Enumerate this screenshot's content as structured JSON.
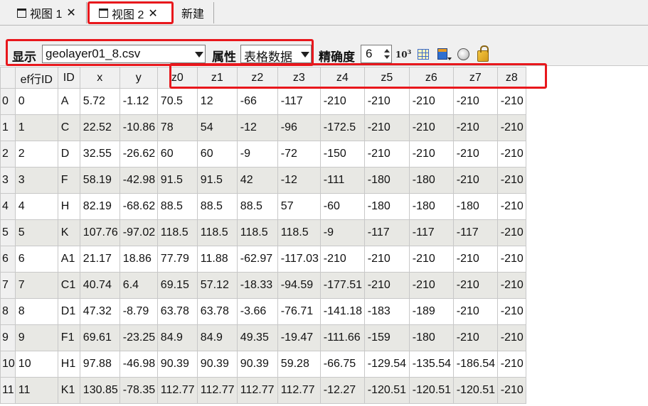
{
  "tabs": [
    {
      "label": "视图 1",
      "icon": "window-icon",
      "close": "✕"
    },
    {
      "label": "视图 2",
      "icon": "window-icon",
      "close": "✕",
      "active": true
    },
    {
      "label": "新建"
    }
  ],
  "toolbar": {
    "display_label": "显示",
    "file_combo_value": "geolayer01_8.csv",
    "property_label": "属性",
    "property_combo_value": "表格数据",
    "precision_label": "精确度",
    "precision_value": "6",
    "exp_icon_text": "10",
    "exp_icon_sup": "3",
    "icons": [
      "exponent-icon",
      "grid-icon",
      "table-dropdown-icon",
      "sphere-icon",
      "lock-icon"
    ]
  },
  "grid": {
    "columns": [
      "ef行ID",
      "ID",
      "x",
      "y",
      "z0",
      "z1",
      "z2",
      "z3",
      "z4",
      "z5",
      "z6",
      "z7",
      "z8"
    ],
    "rows": [
      {
        "index": "0",
        "cells": [
          "0",
          "A",
          "5.72",
          "-1.12",
          "70.5",
          "12",
          "-66",
          "-117",
          "-210",
          "-210",
          "-210",
          "-210",
          "-210"
        ]
      },
      {
        "index": "1",
        "cells": [
          "1",
          "C",
          "22.52",
          "-10.86",
          "78",
          "54",
          "-12",
          "-96",
          "-172.5",
          "-210",
          "-210",
          "-210",
          "-210"
        ]
      },
      {
        "index": "2",
        "cells": [
          "2",
          "D",
          "32.55",
          "-26.62",
          "60",
          "60",
          "-9",
          "-72",
          "-150",
          "-210",
          "-210",
          "-210",
          "-210"
        ]
      },
      {
        "index": "3",
        "cells": [
          "3",
          "F",
          "58.19",
          "-42.98",
          "91.5",
          "91.5",
          "42",
          "-12",
          "-111",
          "-180",
          "-180",
          "-210",
          "-210"
        ]
      },
      {
        "index": "4",
        "cells": [
          "4",
          "H",
          "82.19",
          "-68.62",
          "88.5",
          "88.5",
          "88.5",
          "57",
          "-60",
          "-180",
          "-180",
          "-180",
          "-210"
        ]
      },
      {
        "index": "5",
        "cells": [
          "5",
          "K",
          "107.76",
          "-97.02",
          "118.5",
          "118.5",
          "118.5",
          "118.5",
          "-9",
          "-117",
          "-117",
          "-117",
          "-210"
        ]
      },
      {
        "index": "6",
        "cells": [
          "6",
          "A1",
          "21.17",
          "18.86",
          "77.79",
          "11.88",
          "-62.97",
          "-117.03",
          "-210",
          "-210",
          "-210",
          "-210",
          "-210"
        ]
      },
      {
        "index": "7",
        "cells": [
          "7",
          "C1",
          "40.74",
          "6.4",
          "69.15",
          "57.12",
          "-18.33",
          "-94.59",
          "-177.51",
          "-210",
          "-210",
          "-210",
          "-210"
        ]
      },
      {
        "index": "8",
        "cells": [
          "8",
          "D1",
          "47.32",
          "-8.79",
          "63.78",
          "63.78",
          "-3.66",
          "-76.71",
          "-141.18",
          "-183",
          "-189",
          "-210",
          "-210"
        ]
      },
      {
        "index": "9",
        "cells": [
          "9",
          "F1",
          "69.61",
          "-23.25",
          "84.9",
          "84.9",
          "49.35",
          "-19.47",
          "-111.66",
          "-159",
          "-180",
          "-210",
          "-210"
        ]
      },
      {
        "index": "10",
        "cells": [
          "10",
          "H1",
          "97.88",
          "-46.98",
          "90.39",
          "90.39",
          "90.39",
          "59.28",
          "-66.75",
          "-129.54",
          "-135.54",
          "-186.54",
          "-210"
        ]
      },
      {
        "index": "11",
        "cells": [
          "11",
          "K1",
          "130.85",
          "-78.35",
          "112.77",
          "112.77",
          "112.77",
          "112.77",
          "-12.27",
          "-120.51",
          "-120.51",
          "-120.51",
          "-210"
        ]
      }
    ]
  },
  "colors": {
    "highlight": "#e8171c",
    "grid_line": "#c8c8c8",
    "row_alt": "#e8e8e4",
    "chrome": "#f0f0f0"
  }
}
